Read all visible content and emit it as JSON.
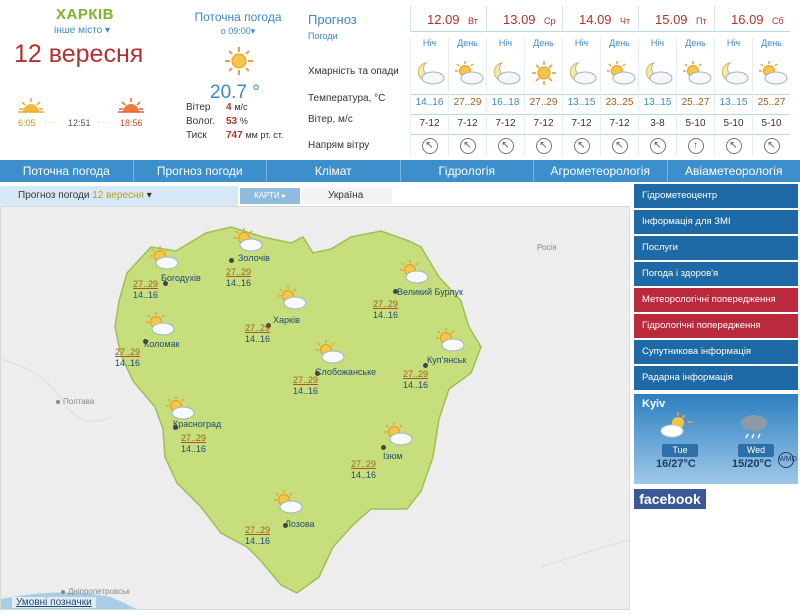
{
  "header": {
    "city": "ХАРКІВ",
    "other_city": "інше місто",
    "date": "12 вересня",
    "sunrise": "6:05",
    "noon": "12:51",
    "sunset": "18:56"
  },
  "current": {
    "title": "Поточна погода",
    "time": "о 09:00",
    "temperature": "20.7 °",
    "wind_label": "Вітер",
    "wind_value": "4",
    "wind_unit": "м/с",
    "humidity_label": "Волог.",
    "humidity_value": "53",
    "humidity_unit": "%",
    "pressure_label": "Тиск",
    "pressure_value": "747",
    "pressure_unit": "мм рт. ст."
  },
  "forecast": {
    "label": "Прогноз",
    "sublabel": "Погоди",
    "row_clouds": "Хмарність та опади",
    "row_temp": "Температура, °С",
    "row_wind": "Вітер, м/с",
    "row_dir": "Напрям вітру",
    "night_label": "Ніч",
    "day_label": "День",
    "days": [
      {
        "date": "12.09",
        "weekday": "Вт",
        "night_temp": "14..16",
        "day_temp": "27..29",
        "night_wind": "7-12",
        "day_wind": "7-12",
        "night_icon": "moon-cloud-icon",
        "day_icon": "sun-cloud-icon"
      },
      {
        "date": "13.09",
        "weekday": "Ср",
        "night_temp": "16..18",
        "day_temp": "27..29",
        "night_wind": "7-12",
        "day_wind": "7-12",
        "night_icon": "moon-cloud-icon",
        "day_icon": "sun-icon"
      },
      {
        "date": "14.09",
        "weekday": "Чт",
        "night_temp": "13..15",
        "day_temp": "23..25",
        "night_wind": "7-12",
        "day_wind": "7-12",
        "night_icon": "moon-cloud-icon",
        "day_icon": "sun-cloud-icon"
      },
      {
        "date": "15.09",
        "weekday": "Пт",
        "night_temp": "13..15",
        "day_temp": "25..27",
        "night_wind": "3-8",
        "day_wind": "5-10",
        "night_icon": "moon-cloud-icon",
        "day_icon": "sun-cloud-icon"
      },
      {
        "date": "16.09",
        "weekday": "Сб",
        "night_temp": "13..15",
        "day_temp": "25..27",
        "night_wind": "5-10",
        "day_wind": "5-10",
        "night_icon": "moon-cloud-icon",
        "day_icon": "sun-cloud-icon"
      }
    ]
  },
  "nav": [
    "Поточна погода",
    "Прогноз погоди",
    "Клімат",
    "Гідрологія",
    "Агрометеорологія",
    "Авіаметеорологія"
  ],
  "map_tabs": {
    "forecast": "Прогноз погоди",
    "forecast_date": "12 вересня",
    "maps": "КАРТИ",
    "ukraine": "Україна"
  },
  "map": {
    "outside": [
      "Полтава",
      "Росія",
      "Дніпропетровськ"
    ],
    "cities": [
      {
        "name": "Золочів",
        "day": "27..29",
        "night": "14..16"
      },
      {
        "name": "Богодухів",
        "day": "27..29",
        "night": "14..16"
      },
      {
        "name": "Великий Бурлук",
        "day": "27..29",
        "night": "14..16"
      },
      {
        "name": "Харків",
        "day": "27..29",
        "night": "14..16"
      },
      {
        "name": "Коломак",
        "day": "27..29",
        "night": "14..16"
      },
      {
        "name": "Куп'янськ",
        "day": "27..29",
        "night": "14..16"
      },
      {
        "name": "Слобожанське",
        "day": "27..29",
        "night": "14..16"
      },
      {
        "name": "Красноград",
        "day": "27..29",
        "night": "14..16"
      },
      {
        "name": "Ізюм",
        "day": "27..29",
        "night": "14..16"
      },
      {
        "name": "Лозова",
        "day": "27..29",
        "night": "14..16"
      }
    ],
    "legend": "Умовні позначки"
  },
  "sidebar": [
    {
      "label": "Гідрометеоцентр",
      "type": "blue"
    },
    {
      "label": "Інформація для ЗМІ",
      "type": "blue"
    },
    {
      "label": "Послуги",
      "type": "blue"
    },
    {
      "label": "Погода і здоров'я",
      "type": "blue"
    },
    {
      "label": "Метеорологічні попередження",
      "type": "red"
    },
    {
      "label": "Гідрологічні попередження",
      "type": "red"
    },
    {
      "label": "Супутникова інформація",
      "type": "blue"
    },
    {
      "label": "Радарна інформація",
      "type": "blue"
    }
  ],
  "kyiv_widget": {
    "city": "Kyiv",
    "day1": "Tue",
    "day1_temp": "16/27°C",
    "day2": "Wed",
    "day2_temp": "15/20°C",
    "wmo": "WMO"
  },
  "facebook": "facebook",
  "colors": {
    "accent_blue": "#3d8fcb",
    "city_green": "#7cb32a",
    "date_red": "#b23131",
    "map_region": "#c6de7c",
    "warning_red": "#bb2a3c",
    "sidebar_blue": "#1d6aa6"
  }
}
